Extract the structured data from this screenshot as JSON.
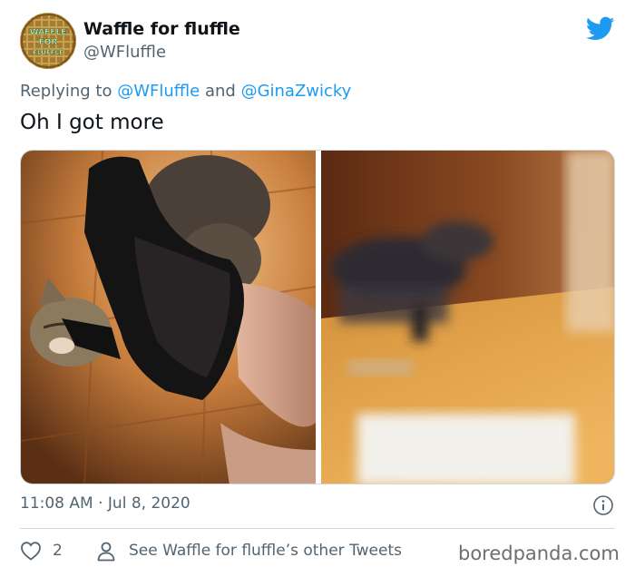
{
  "author": {
    "display_name": "Waffle for fluffle",
    "handle": "@WFluffle",
    "avatar_icon": "waffle-avatar",
    "avatar_text": "WAFFLE FOR FLUFFLE"
  },
  "reply": {
    "prefix": "Replying to ",
    "mention_1": "@WFluffle",
    "conjunction": " and ",
    "mention_2": "@GinaZwicky"
  },
  "text": "Oh I got more",
  "media": [
    {
      "icon": "photo-cat-and-heel"
    },
    {
      "icon": "photo-blurry-cat-running"
    }
  ],
  "timestamp": "11:08 AM · Jul 8, 2020",
  "actions": {
    "like_count": "2",
    "other_tweets_label": "See Waffle for fluffle’s other Tweets"
  },
  "watermark": "boredpanda.com",
  "colors": {
    "accent": "#1d9bf0",
    "secondary_text": "#536471",
    "primary_text": "#0f1419",
    "border": "#cfd9de"
  }
}
